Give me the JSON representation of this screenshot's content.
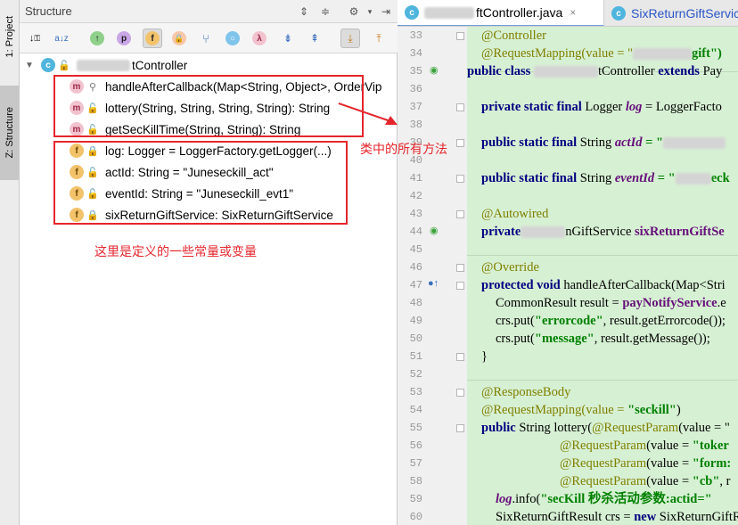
{
  "left_strip": {
    "project_tab": "1: Project",
    "structure_tab": "Z: Structure"
  },
  "structure_panel": {
    "title": "Structure",
    "class_name_suffix": "tController",
    "methods": [
      {
        "text": "handleAfterCallback(Map<String, Object>, OrderVip",
        "visibility": "protected"
      },
      {
        "text": "lottery(String, String, String, String): String",
        "visibility": "public"
      },
      {
        "text": "getSecKillTime(String, String): String",
        "visibility": "public"
      }
    ],
    "fields": [
      {
        "text": "log: Logger = LoggerFactory.getLogger(...)",
        "visibility": "private"
      },
      {
        "text": "actId: String = \"Juneseckill_act\"",
        "visibility": "public"
      },
      {
        "text": "eventId: String = \"Juneseckill_evt1\"",
        "visibility": "public"
      },
      {
        "text": "sixReturnGiftService: SixReturnGiftService",
        "visibility": "private"
      }
    ],
    "annotation_methods": "类中的所有方法",
    "annotation_fields": "这里是定义的一些常量或变量"
  },
  "editor": {
    "tab_active_suffix": "ftController.java",
    "tab_second": "SixReturnGiftServic",
    "line_numbers": [
      "33",
      "34",
      "35",
      "36",
      "37",
      "38",
      "39",
      "40",
      "41",
      "42",
      "43",
      "44",
      "45",
      "46",
      "47",
      "48",
      "49",
      "50",
      "51",
      "52",
      "53",
      "54",
      "55",
      "56",
      "57",
      "58",
      "59",
      "60"
    ],
    "code": {
      "l33": "@Controller",
      "l34_a": "@RequestMapping(value = \"",
      "l34_b": "gift\")",
      "l35_a": "public class ",
      "l35_b": "tController ",
      "l35_c": "extends ",
      "l35_d": "Pay",
      "l37_a": "private static final ",
      "l37_b": "Logger ",
      "l37_c": "log",
      "l37_d": " = LoggerFacto",
      "l39_a": "public static final ",
      "l39_b": "String ",
      "l39_c": "actId",
      "l39_d": " = \"",
      "l41_a": "public static final ",
      "l41_b": "String ",
      "l41_c": "eventId",
      "l41_d": " = \"",
      "l41_e": "eck",
      "l43": "@Autowired",
      "l44_a": "private",
      "l44_b": "nGiftService ",
      "l44_c": "sixReturnGiftSe",
      "l46": "@Override",
      "l47_a": "protected void ",
      "l47_b": "handleAfterCallback(Map<Stri",
      "l48_a": "CommonResult result = ",
      "l48_b": "payNotifyService",
      "l48_c": ".e",
      "l49_a": "crs.put(",
      "l49_b": "\"errorcode\"",
      "l49_c": ", result.getErrorcode());",
      "l50_a": "crs.put(",
      "l50_b": "\"message\"",
      "l50_c": ", result.getMessage());",
      "l51": "}",
      "l53": "@ResponseBody",
      "l54_a": "@RequestMapping(value = ",
      "l54_b": "\"seckill\"",
      "l54_c": ")",
      "l55_a": "public ",
      "l55_b": "String lottery(",
      "l55_c": "@RequestParam",
      "l55_d": "(value = \"",
      "l56_a": "@RequestParam",
      "l56_b": "(value = ",
      "l56_c": "\"toker",
      "l57_a": "@RequestParam",
      "l57_b": "(value = ",
      "l57_c": "\"form:",
      "l58_a": "@RequestParam",
      "l58_b": "(value = ",
      "l58_c": "\"cb\"",
      "l58_d": ", r",
      "l59_a": "log",
      "l59_b": ".info(",
      "l59_c": "\"secKill 秒杀活动参数:actid=\"",
      "l60_a": "SixReturnGiftResult crs = ",
      "l60_b": "new ",
      "l60_c": "SixReturnGiftR"
    }
  },
  "colors": {
    "annotation_red": "#e4262c",
    "code_background": "#d6f0d3",
    "keyword": "#000080",
    "string": "#008000",
    "field": "#660e7a",
    "annotation": "#808000"
  }
}
